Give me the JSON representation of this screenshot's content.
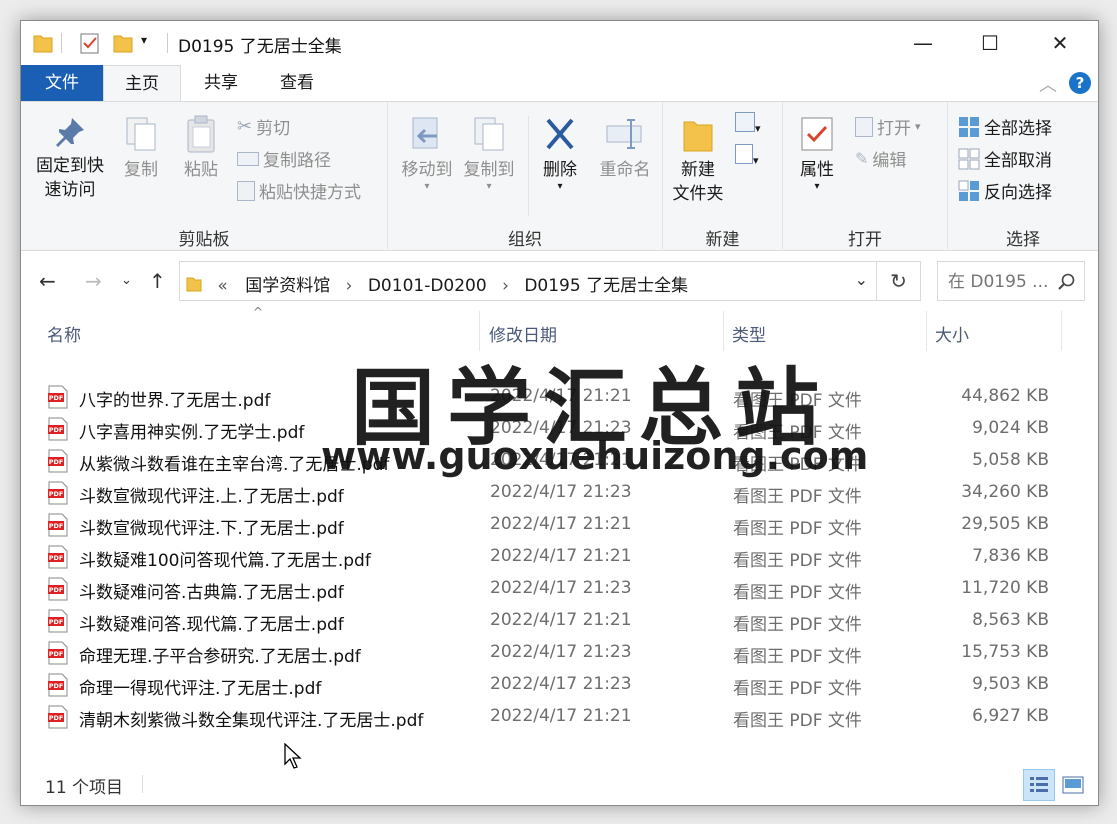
{
  "window": {
    "title": "D0195 了无居士全集",
    "minimize_glyph": "—",
    "maximize_glyph": "☐",
    "close_glyph": "✕"
  },
  "tabs": [
    {
      "label": "文件"
    },
    {
      "label": "主页"
    },
    {
      "label": "共享"
    },
    {
      "label": "查看"
    }
  ],
  "ribbon": {
    "clipboard": {
      "group_label": "剪贴板",
      "pin_label_1": "固定到快",
      "pin_label_2": "速访问",
      "copy_label": "复制",
      "paste_label": "粘贴",
      "cut_label": "剪切",
      "copy_path_label": "复制路径",
      "paste_shortcut_label": "粘贴快捷方式"
    },
    "organize": {
      "group_label": "组织",
      "move_label": "移动到",
      "copy_to_label": "复制到",
      "delete_label": "删除",
      "rename_label": "重命名"
    },
    "new": {
      "group_label": "新建",
      "new_folder_1": "新建",
      "new_folder_2": "文件夹"
    },
    "open": {
      "group_label": "打开",
      "properties_label": "属性",
      "open_label": "打开",
      "edit_label": "编辑"
    },
    "select": {
      "group_label": "选择",
      "select_all_label": "全部选择",
      "select_none_label": "全部取消",
      "invert_label": "反向选择"
    }
  },
  "address": {
    "overflow": "«",
    "crumbs": [
      "国学资料馆",
      "D0101-D0200",
      "D0195 了无居士全集"
    ],
    "separator": "›",
    "search_placeholder": "在 D0195 ..."
  },
  "columns": {
    "name": "名称",
    "date": "修改日期",
    "type": "类型",
    "size": "大小"
  },
  "files": [
    {
      "name": "八字的世界.了无居士.pdf",
      "date": "2022/4/17 21:21",
      "type": "看图王 PDF 文件",
      "size": "44,862 KB"
    },
    {
      "name": "八字喜用神实例.了无学士.pdf",
      "date": "2022/4/17 21:23",
      "type": "看图王 PDF 文件",
      "size": "9,024 KB"
    },
    {
      "name": "从紫微斗数看谁在主宰台湾.了无居士.pdf",
      "date": "2022/4/17 21:21",
      "type": "看图王 PDF 文件",
      "size": "5,058 KB"
    },
    {
      "name": "斗数宣微现代评注.上.了无居士.pdf",
      "date": "2022/4/17 21:23",
      "type": "看图王 PDF 文件",
      "size": "34,260 KB"
    },
    {
      "name": "斗数宣微现代评注.下.了无居士.pdf",
      "date": "2022/4/17 21:21",
      "type": "看图王 PDF 文件",
      "size": "29,505 KB"
    },
    {
      "name": "斗数疑难100问答现代篇.了无居士.pdf",
      "date": "2022/4/17 21:21",
      "type": "看图王 PDF 文件",
      "size": "7,836 KB"
    },
    {
      "name": "斗数疑难问答.古典篇.了无居士.pdf",
      "date": "2022/4/17 21:23",
      "type": "看图王 PDF 文件",
      "size": "11,720 KB"
    },
    {
      "name": "斗数疑难问答.现代篇.了无居士.pdf",
      "date": "2022/4/17 21:21",
      "type": "看图王 PDF 文件",
      "size": "8,563 KB"
    },
    {
      "name": "命理无理.子平合参研究.了无居士.pdf",
      "date": "2022/4/17 21:23",
      "type": "看图王 PDF 文件",
      "size": "15,753 KB"
    },
    {
      "name": "命理一得现代评注.了无居士.pdf",
      "date": "2022/4/17 21:23",
      "type": "看图王 PDF 文件",
      "size": "9,503 KB"
    },
    {
      "name": "清朝木刻紫微斗数全集现代评注.了无居士.pdf",
      "date": "2022/4/17 21:21",
      "type": "看图王 PDF 文件",
      "size": "6,927 KB"
    }
  ],
  "watermark": {
    "title": "国学汇总站",
    "url": "www.guoxuehuizong.com"
  },
  "status": {
    "item_count": "11 个项目"
  },
  "colors": {
    "file_tab": "#1a5fb4",
    "help": "#1a73c8",
    "selected_view": "#cce4f7"
  }
}
